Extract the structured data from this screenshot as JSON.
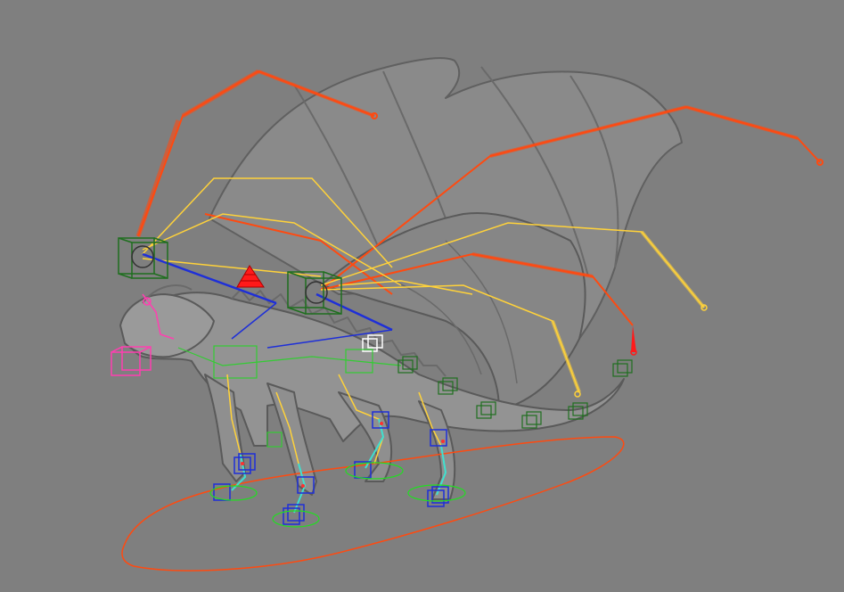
{
  "viewport": {
    "background": "#7f7f7f",
    "mesh_color": "#5e5e5e",
    "mesh_highlight": "#9a9a9a"
  },
  "rig": {
    "colors": {
      "wing_chain_left": "#ff4a10",
      "wing_chain_right": "#ffd23a",
      "wing_ik": "#1e2fd8",
      "spine": "#33cc33",
      "head": "#ff3fb0",
      "legs": "#1e2fd8",
      "leg_bones": "#3fe0d0",
      "leg_joints": "#ff3030",
      "feet": "#22dd22",
      "tail_ctrl": "#1f6f1f",
      "ground_ctrl": "#ff4a10",
      "target": "#ff1a1a",
      "selection": "#ffffff"
    },
    "icons": {
      "target": "cone-icon",
      "selection": "cube-icon"
    }
  }
}
